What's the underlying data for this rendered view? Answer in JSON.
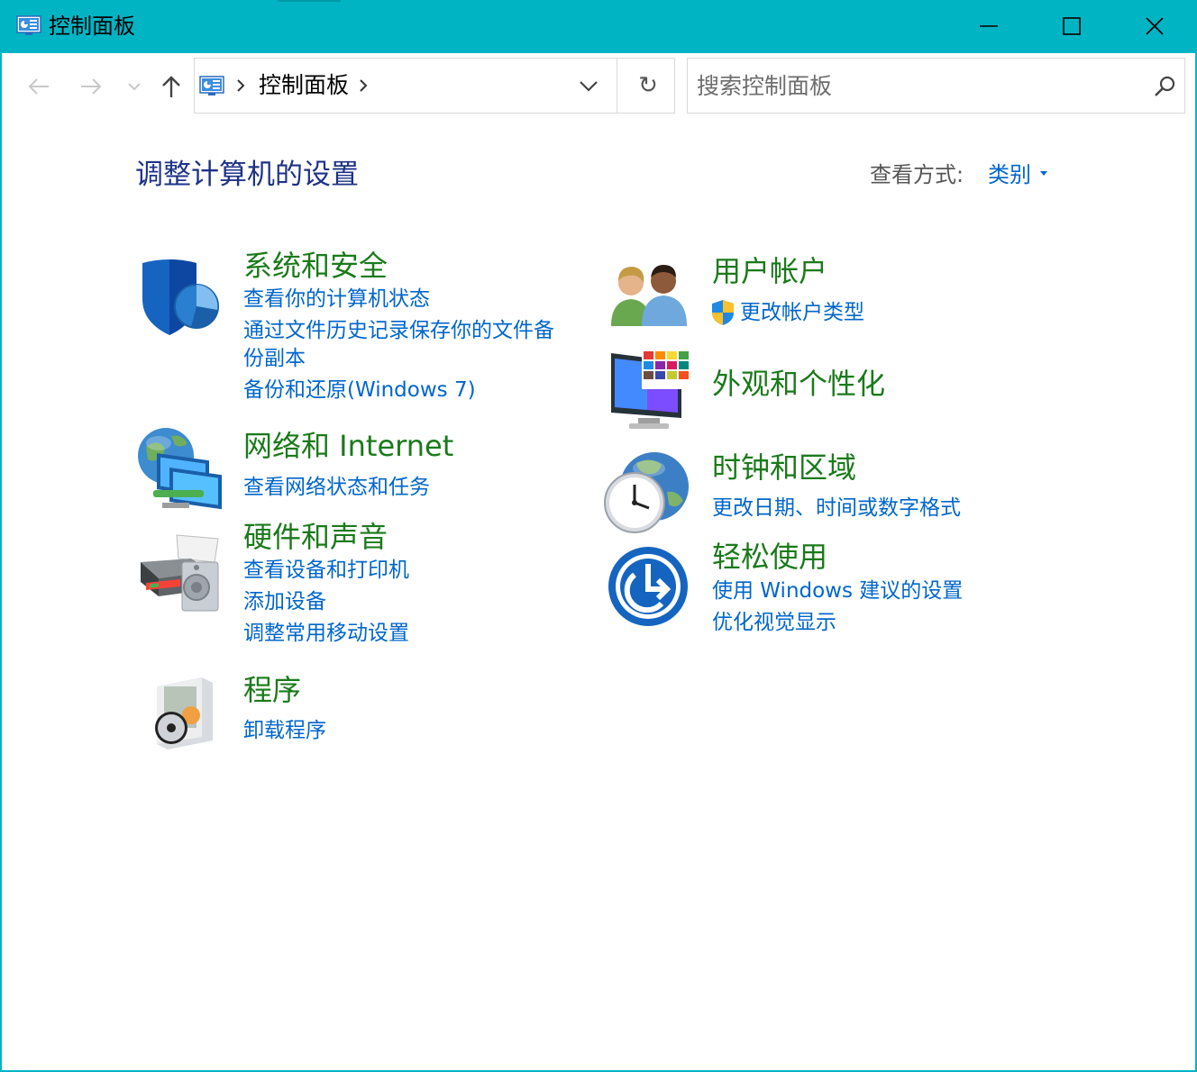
{
  "window": {
    "title": "控制面板",
    "minimize_label": "",
    "accent": "#00b4c4"
  },
  "nav": {
    "back_icon": "arrow-left-icon",
    "forward_icon": "arrow-right-icon",
    "recent_icon": "chevron-down-icon",
    "up_icon": "arrow-up-icon",
    "breadcrumb": "控制面板",
    "refresh_glyph": "↻",
    "search_placeholder": "搜索控制面板"
  },
  "content": {
    "title": "调整计算机的设置",
    "view_label": "查看方式:",
    "view_value": "类别",
    "title_color": "#1e3287",
    "category_color": "#1a7a1a",
    "link_color": "#0066cc"
  },
  "categories": {
    "system": {
      "title": "系统和安全",
      "icon": "shield-icon",
      "links": [
        "查看你的计算机状态",
        "通过文件历史记录保存你的文件备",
        "份副本",
        "备份和还原(Windows 7)"
      ]
    },
    "network": {
      "title": "网络和 Internet",
      "icon": "network-globe-icon",
      "links": [
        "查看网络状态和任务"
      ]
    },
    "hardware": {
      "title": "硬件和声音",
      "icon": "printer-speaker-icon",
      "links": [
        "查看设备和打印机",
        "添加设备",
        "调整常用移动设置"
      ]
    },
    "programs": {
      "title": "程序",
      "icon": "programs-disc-icon",
      "links": [
        "卸载程序"
      ]
    },
    "users": {
      "title": "用户帐户",
      "icon": "users-icon",
      "links": [
        "更改帐户类型"
      ],
      "link_icon": "uac-shield-icon"
    },
    "appearance": {
      "title": "外观和个性化",
      "icon": "monitor-palette-icon",
      "links": []
    },
    "clock": {
      "title": "时钟和区域",
      "icon": "clock-globe-icon",
      "links": [
        "更改日期、时间或数字格式"
      ]
    },
    "ease": {
      "title": "轻松使用",
      "icon": "ease-of-access-icon",
      "links": [
        "使用 Windows 建议的设置",
        "优化视觉显示"
      ]
    }
  }
}
